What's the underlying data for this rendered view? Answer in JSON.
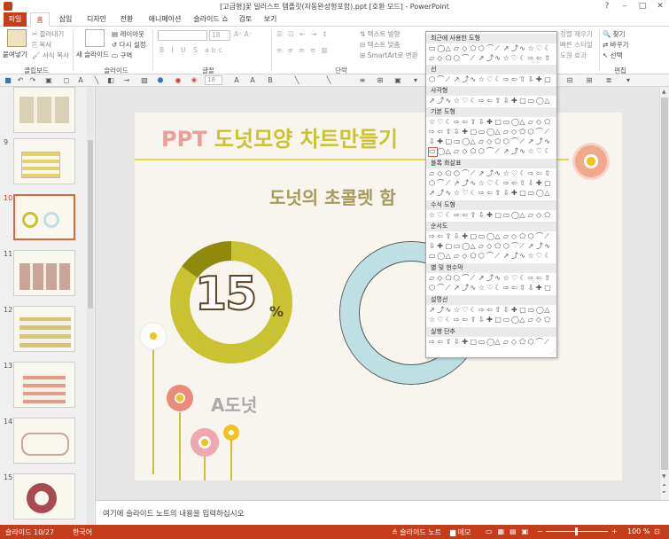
{
  "window": {
    "title": "[고급형]꽃 일러스트 템플릿(자동완성형포함).ppt [호환 모드] - PowerPoint"
  },
  "tabs": [
    "파일",
    "홈",
    "삽입",
    "디자인",
    "전환",
    "애니메이션",
    "슬라이드 쇼",
    "검토",
    "보기"
  ],
  "ribbon": {
    "paste": "붙여넣기",
    "cut": "잘라내기",
    "copy": "복사",
    "format_painter": "서식 복사",
    "new_slide": "새 슬라이드",
    "layout": "레이아웃",
    "reset": "다시 설정",
    "section": "구역",
    "font_size": "18",
    "text_direction": "텍스트 방향",
    "align_text": "텍스트 맞춤",
    "smartart": "SmartArt로 변환",
    "arrange": "정렬 재우기",
    "quick_styles": "빠른 스타일",
    "shape_effects": "도형 효과",
    "find": "찾기",
    "replace": "바꾸기",
    "select": "선택",
    "groups": {
      "clipboard": "클립보드",
      "slides": "슬라이드",
      "font": "글꼴",
      "paragraph": "단락",
      "editing": "편집"
    }
  },
  "qat": {
    "font_size": "18"
  },
  "slides_panel": [
    {
      "num": "9"
    },
    {
      "num": "10"
    },
    {
      "num": "11"
    },
    {
      "num": "12"
    },
    {
      "num": "13"
    },
    {
      "num": "14"
    },
    {
      "num": "15"
    }
  ],
  "slide": {
    "title_ppt": "PPT",
    "title_rest": "도넛모양 차트만들기",
    "subtitle": "도넛의 초콜렛 함",
    "donut_value": "15",
    "donut_unit": "%",
    "donut_label": "A도넛",
    "colors": {
      "olive": "#c9c232",
      "dark_olive": "#8f8a0e",
      "blue_ring": "#bfe0e3",
      "pink": "#e9a09a"
    }
  },
  "shapes_menu": {
    "sections": [
      "최근에 사용한 도형",
      "선",
      "사각형",
      "기본 도형",
      "블록 화살표",
      "수식 도형",
      "순서도",
      "별 및 현수막",
      "설명선",
      "실행 단추"
    ]
  },
  "notes": {
    "placeholder": "여기에 슬라이드 노트의 내용을 입력하십시오"
  },
  "status": {
    "slide_info": "슬라이드 10/27",
    "language": "한국어",
    "notes_btn": "슬라이드 노트",
    "comments_btn": "메모",
    "zoom": "100 %"
  }
}
